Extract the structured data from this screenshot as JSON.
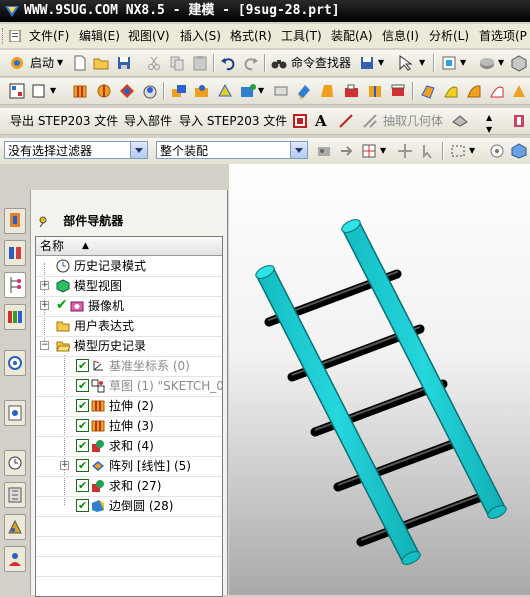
{
  "title": {
    "text": "WWW.9SUG.COM NX8.5 - 建模 - [9sug-28.prt]"
  },
  "menu": {
    "items": [
      "文件(F)",
      "编辑(E)",
      "视图(V)",
      "插入(S)",
      "格式(R)",
      "工具(T)",
      "装配(A)",
      "信息(I)",
      "分析(L)",
      "首选项(P"
    ]
  },
  "toolbar1": {
    "start_label": "启动",
    "command_finder_label": "命令查找器"
  },
  "toolbar3": {
    "export_step": "导出 STEP203 文件",
    "import_part": "导入部件",
    "import_step": "导入 STEP203 文件",
    "text_icon_glyph": "A",
    "extract_geometry": "抽取几何体"
  },
  "filters": {
    "selection_filter": "没有选择过滤器",
    "assembly_scope": "整个装配"
  },
  "navigator": {
    "title": "部件导航器",
    "column_header": "名称",
    "rows": [
      {
        "label": "历史记录模式",
        "icon": "clock-icon"
      },
      {
        "label": "模型视图",
        "icon": "model-view-icon"
      },
      {
        "label": "摄像机",
        "icon": "camera-icon"
      },
      {
        "label": "用户表达式",
        "icon": "folder-icon"
      },
      {
        "label": "模型历史记录",
        "icon": "folder-open-icon"
      },
      {
        "label": "基准坐标系 (0)",
        "icon": "datum-csys-icon"
      },
      {
        "label": "草图 (1) \"SKETCH_0",
        "icon": "sketch-icon"
      },
      {
        "label": "拉伸 (2)",
        "icon": "extrude-icon"
      },
      {
        "label": "拉伸 (3)",
        "icon": "extrude-icon"
      },
      {
        "label": "求和 (4)",
        "icon": "unite-icon"
      },
      {
        "label": "阵列 [线性] (5)",
        "icon": "pattern-icon"
      },
      {
        "label": "求和 (27)",
        "icon": "unite-icon"
      },
      {
        "label": "边倒圆 (28)",
        "icon": "edge-blend-icon"
      }
    ]
  },
  "colors": {
    "rail": "#1fd2d7",
    "rung": "#111111",
    "viewport_bottom": "#a9a9a9"
  }
}
